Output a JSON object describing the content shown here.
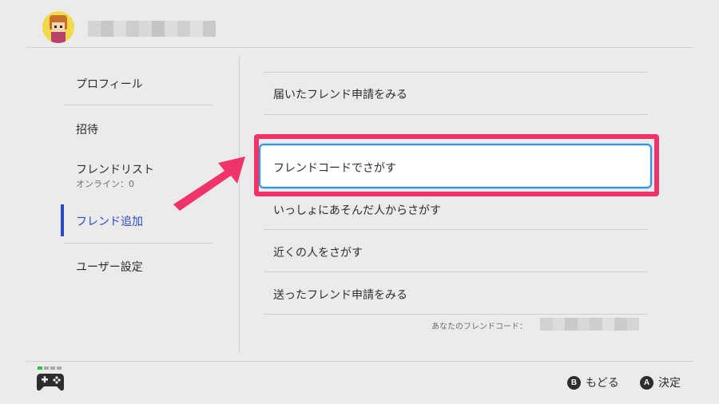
{
  "sidebar": {
    "items": [
      {
        "label": "プロフィール"
      },
      {
        "label": "招待"
      },
      {
        "label": "フレンドリスト",
        "sub": "オンライン：0"
      },
      {
        "label": "フレンド追加"
      },
      {
        "label": "ユーザー設定"
      }
    ],
    "active_index": 3
  },
  "menu": {
    "items": [
      {
        "label": "届いたフレンド申請をみる"
      },
      {
        "label": "フレンドコードでさがす"
      },
      {
        "label": "いっしょにあそんだ人からさがす"
      },
      {
        "label": "近くの人をさがす"
      },
      {
        "label": "送ったフレンド申請をみる"
      }
    ],
    "selected_index": 1
  },
  "friend_code_label": "あなたのフレンドコード：",
  "footer": {
    "b_button": "B",
    "back_label": "もどる",
    "a_button": "A",
    "confirm_label": "決定"
  },
  "colors": {
    "accent": "#2a4ac4",
    "highlight_frame": "#f0346a",
    "selection_border": "#3a93d8",
    "arrow": "#f0346a",
    "background": "#ebebeb"
  },
  "icons": {
    "avatar": "user-avatar",
    "controller": "controller-icon",
    "arrow": "pointer-arrow-icon"
  }
}
